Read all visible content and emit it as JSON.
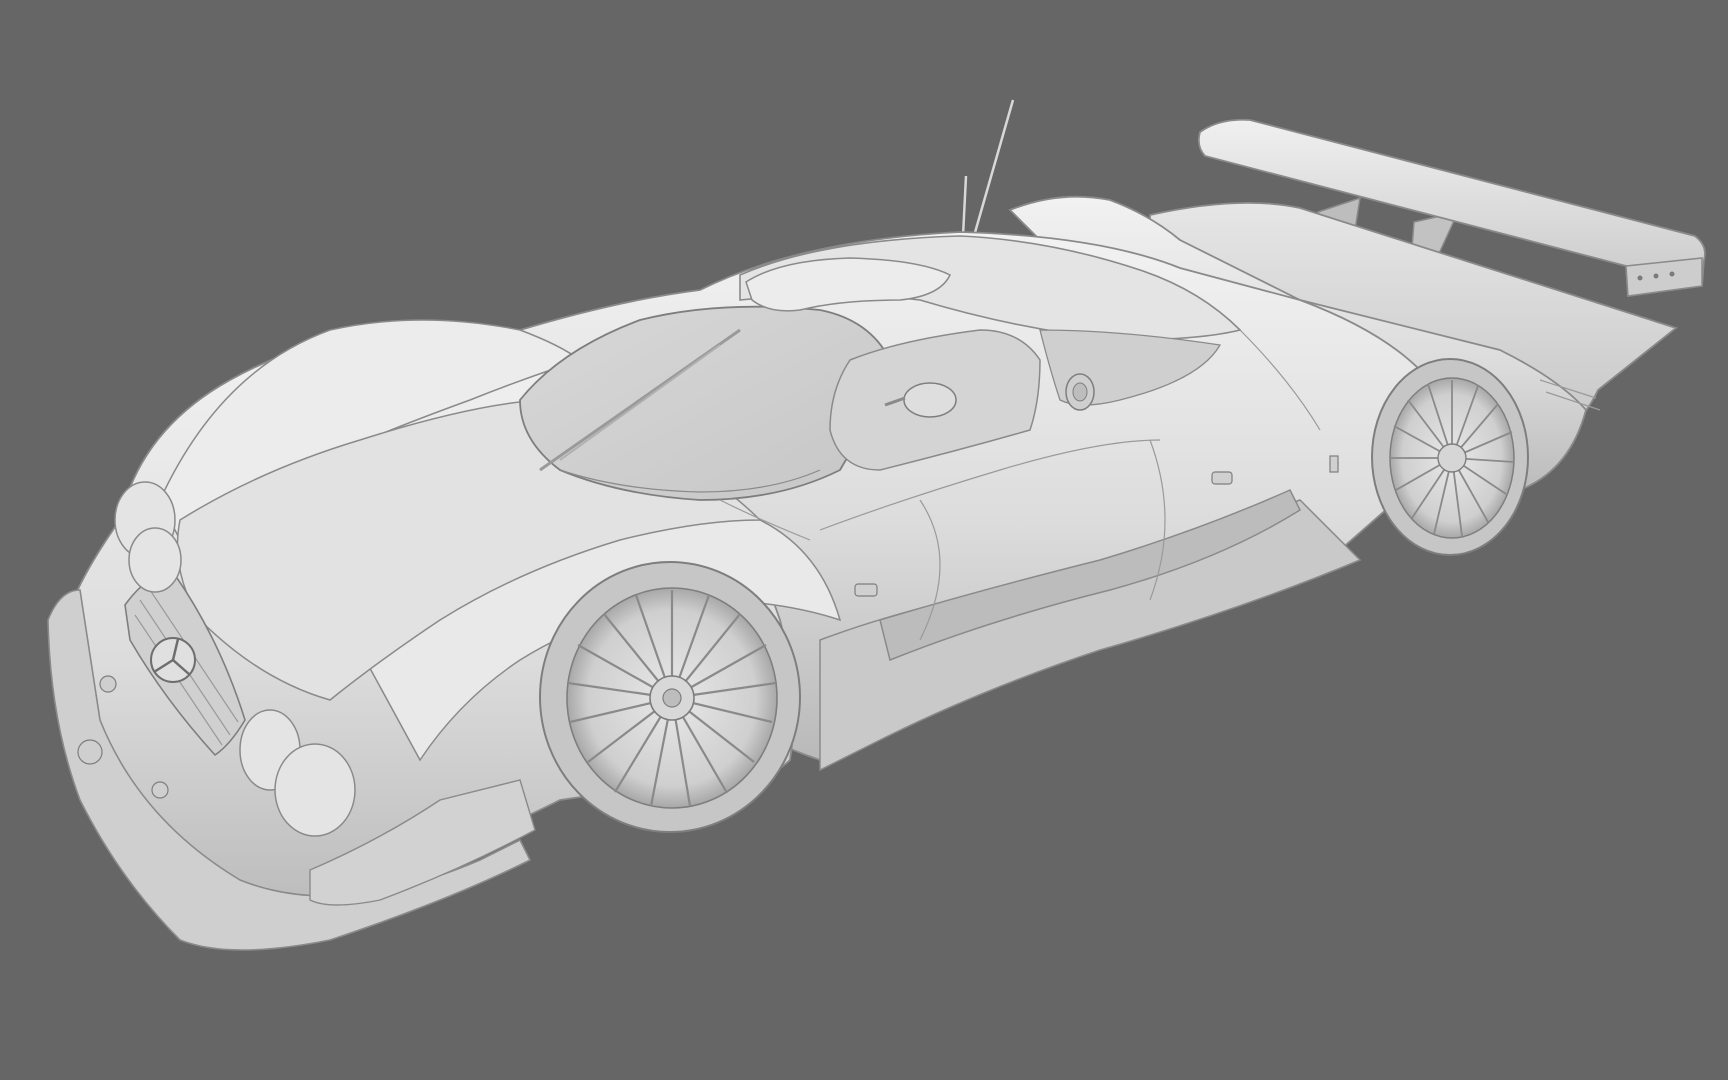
{
  "scene": {
    "background_color": "#666666",
    "subject": "race-car-clay-render",
    "body_color": "#e0e0e0",
    "shadow_color": "#bdbdbd",
    "line_color": "#8a8a8a",
    "emblem": "three-pointed-star-icon",
    "text": []
  }
}
